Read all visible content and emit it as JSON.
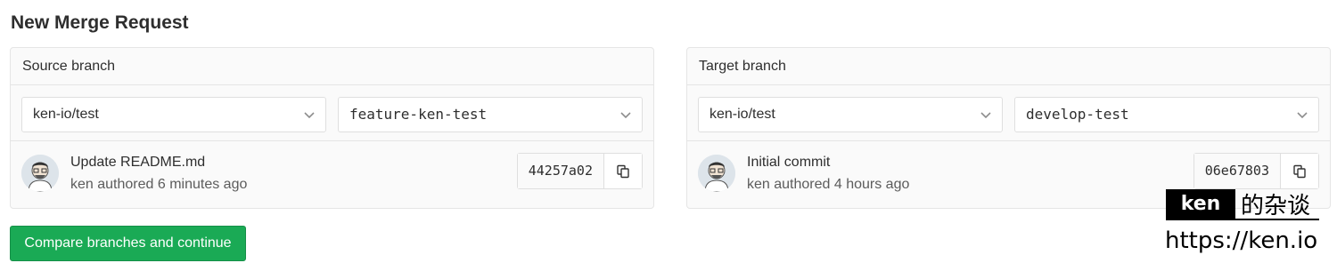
{
  "page": {
    "title": "New Merge Request"
  },
  "source": {
    "header": "Source branch",
    "project": "ken-io/test",
    "branch": "feature-ken-test",
    "commit": {
      "title": "Update README.md",
      "meta": "ken authored 6 minutes ago",
      "sha": "44257a02"
    }
  },
  "target": {
    "header": "Target branch",
    "project": "ken-io/test",
    "branch": "develop-test",
    "commit": {
      "title": "Initial commit",
      "meta": "ken authored 4 hours ago",
      "sha": "06e67803"
    }
  },
  "actions": {
    "compare_label": "Compare branches and continue"
  },
  "watermark": {
    "brand": "ken",
    "suffix": "的杂谈",
    "url": "https://ken.io"
  },
  "colors": {
    "primary_button": "#1aaa55",
    "panel_background": "#fafafa",
    "border": "#e5e5e5"
  },
  "icons": {
    "select_caret": "chevron-down-icon",
    "copy": "copy-icon",
    "avatar": "user-avatar-icon"
  }
}
